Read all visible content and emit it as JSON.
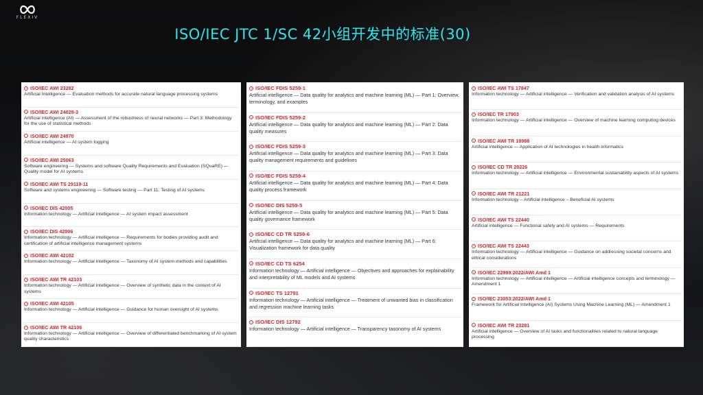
{
  "logo": {
    "text": "FLEXIV"
  },
  "title": "ISO/IEC JTC 1/SC 42小组开发中的标准(30)",
  "columns": [
    [
      {
        "code": "ISO/IEC AWI 23282",
        "desc": "Artificial Intelligence — Evaluation methods for accurate natural language processing systems"
      },
      {
        "code": "ISO/IEC AWI 24029-3",
        "desc": "Artificial intelligence (AI) — Assessment of the robustness of neural networks — Part 3: Methodology for the use of statistical methods"
      },
      {
        "code": "ISO/IEC AWI 24970",
        "desc": "Artificial intelligence — AI system logging"
      },
      {
        "code": "ISO/IEC AWI 25063",
        "desc": "Software engineering — Systems and software Quality Requirements and Evaluation (SQuaRE) — Quality model for AI systems"
      },
      {
        "code": "ISO/IEC AWI TS 29119-11",
        "desc": "Software and systems engineering — Software testing — Part 11: Testing of AI systems"
      },
      {
        "code": "ISO/IEC DIS 42005",
        "desc": "Information technology — Artificial intelligence — AI system impact assessment"
      },
      {
        "code": "ISO/IEC DIS 42006",
        "desc": "Information technology — Artificial intelligence — Requirements for bodies providing audit and certification of artificial intelligence management systems"
      },
      {
        "code": "ISO/IEC AWI 42102",
        "desc": "Information technology — Artificial intelligence — Taxonomy of AI system methods and capabilities"
      },
      {
        "code": "ISO/IEC AWI TR 42103",
        "desc": "Information technology — Artificial intelligence — Overview of synthetic data in the context of AI systems"
      },
      {
        "code": "ISO/IEC AWI 42105",
        "desc": "Information technology — Artificial intelligence — Guidance for human oversight of AI systems"
      },
      {
        "code": "ISO/IEC AWI TR 42106",
        "desc": "Information technology — Artificial intelligence — Overview of differentiated benchmarking of AI system quality characteristics"
      }
    ],
    [
      {
        "code": "ISO/IEC FDIS 5259-1",
        "desc": "Artificial intelligence — Data quality for analytics and machine learning (ML) — Part 1: Overview, terminology, and examples"
      },
      {
        "code": "ISO/IEC FDIS 5259-2",
        "desc": "Artificial intelligence — Data quality for analytics and machine learning (ML) — Part 2: Data quality measures"
      },
      {
        "code": "ISO/IEC FDIS 5259-3",
        "desc": "Artificial intelligence — Data quality for analytics and machine learning (ML) — Part 3: Data quality management requirements and guidelines"
      },
      {
        "code": "ISO/IEC FDIS 5259-4",
        "desc": "Artificial intelligence — Data quality for analytics and machine learning (ML) — Part 4: Data quality process framework"
      },
      {
        "code": "ISO/IEC DIS 5259-5",
        "desc": "Artificial intelligence — Data quality for analytics and machine learning (ML) — Part 5: Data quality governance framework"
      },
      {
        "code": "ISO/IEC CD TR 5259-6",
        "desc": "Artificial intelligence — Data quality for analytics and machine learning (ML) — Part 6: Visualization framework for data quality"
      },
      {
        "code": "ISO/IEC CD TS 6254",
        "desc": "Information technology — Artificial intelligence — Objectives and approaches for explainability and interpretability of ML models and AI systems"
      },
      {
        "code": "ISO/IEC TS 12791",
        "desc": "Information technology — Artificial intelligence — Treatment of unwanted bias in classification and regression machine learning tasks"
      },
      {
        "code": "ISO/IEC DIS 12792",
        "desc": "Information technology — Artificial intelligence — Transparency taxonomy of AI systems"
      }
    ],
    [
      {
        "code": "ISO/IEC AWI TS 17847",
        "desc": "Information technology — Artificial intelligence — Verification and validation analysis of AI systems"
      },
      {
        "code": "ISO/IEC TR 17903",
        "desc": "Information technology — Artificial intelligence — Overview of machine learning computing devices"
      },
      {
        "code": "ISO/IEC AWI TR 18988",
        "desc": "Artificial intelligence — Application of AI technologies in health informatics"
      },
      {
        "code": "ISO/IEC CD TR 20226",
        "desc": "Information technology — Artificial intelligence — Environmental sustainability aspects of AI systems"
      },
      {
        "code": "ISO/IEC AWI TR 21221",
        "desc": "Information technology – Artificial intelligence – Beneficial AI systems"
      },
      {
        "code": "ISO/IEC AWI TS 22440",
        "desc": "Artificial intelligence — Functional safety and AI systems — Requirements"
      },
      {
        "code": "ISO/IEC AWI TS 22443",
        "desc": "Information technology — Artificial intelligence — Guidance on addressing societal concerns and ethical considerations"
      },
      {
        "code": "ISO/IEC 22989:2022/AWI Amd 1",
        "desc": "Information technology — Artificial intelligence — Artificial intelligence concepts and terminology — Amendment 1"
      },
      {
        "code": "ISO/IEC 23053:2022/AWI Amd 1",
        "desc": "Framework for Artificial Intelligence (AI) Systems Using Machine Learning (ML) — Amendment 1"
      },
      {
        "code": "ISO/IEC AWI TR 23281",
        "desc": "Artificial intelligence — Overview of AI tasks and functionalities related to natural language processing"
      }
    ]
  ]
}
